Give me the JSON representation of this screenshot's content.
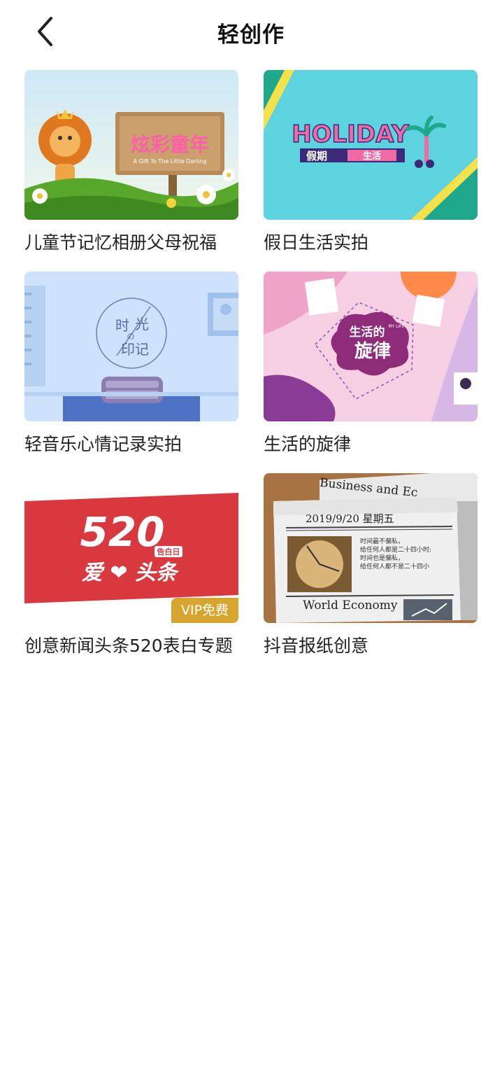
{
  "header": {
    "title": "轻创作",
    "back_icon": "chevron-left-icon"
  },
  "templates": [
    {
      "title": "儿童节记忆相册父母祝福",
      "thumb_sign": "炫彩童年",
      "thumb_sign_sub": "A Gift To The Little Darling"
    },
    {
      "title": "假日生活实拍",
      "thumb_word": "HOLIDAY",
      "thumb_sub_left": "假期",
      "thumb_sub_right": "生活"
    },
    {
      "title": "轻音乐心情记录实拍",
      "thumb_line1": "时",
      "thumb_line1b": "光",
      "thumb_small": "の",
      "thumb_line2": "印记"
    },
    {
      "title": "生活的旋律",
      "thumb_line1": "生活的",
      "thumb_line2": "旋律",
      "thumb_side": "MY LIFE"
    },
    {
      "title": "创意新闻头条520表白专题",
      "thumb_number": "520",
      "thumb_tag": "告白日",
      "thumb_line": "爱 ❤ 头条",
      "badge": "VIP免费"
    },
    {
      "title": "抖音报纸创意",
      "thumb_head": "Business and Ec",
      "thumb_date": "2019/9/20 星期五",
      "thumb_text": [
        "时间最不偏私，",
        "给任何人都是二十四小时;",
        "时间也是偏私，",
        "给任何人都不是二十四小"
      ],
      "thumb_foot": "World Economy"
    }
  ]
}
